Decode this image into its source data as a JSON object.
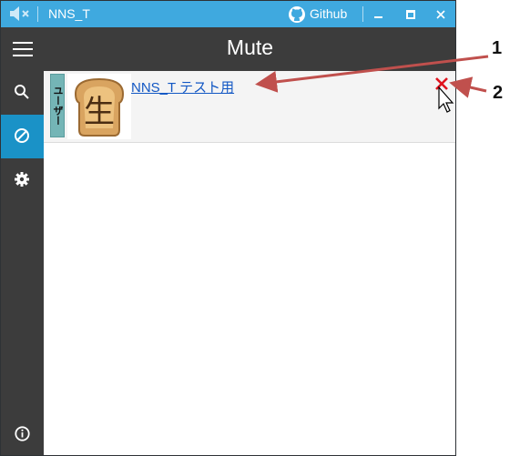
{
  "window": {
    "title": "NNS_T",
    "github_label": "Github"
  },
  "header": {
    "title": "Mute"
  },
  "sidebar": {
    "items": [
      {
        "icon": "search-icon"
      },
      {
        "icon": "block-icon",
        "active": true
      },
      {
        "icon": "gear-icon"
      }
    ],
    "bottom_icon": "info-icon"
  },
  "mutes": [
    {
      "type_label": "ユーザー",
      "name": "NNS_T テスト用",
      "avatar_glyph": "生"
    }
  ],
  "annotations": {
    "label_1": "1",
    "label_2": "2"
  },
  "colors": {
    "titlebar": "#3fa9df",
    "header": "#3c3c3c",
    "active_nav": "#1a92c7",
    "remove": "#e0141e",
    "arrow": "#c0504d"
  }
}
